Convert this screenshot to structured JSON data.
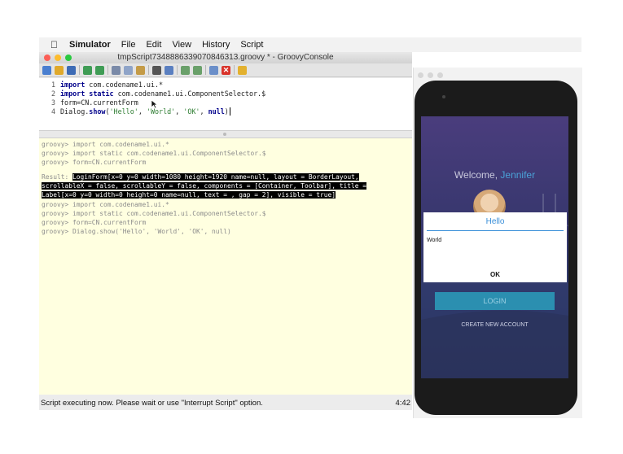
{
  "menubar": {
    "apple": "",
    "app_name": "Simulator",
    "items": [
      "File",
      "Edit",
      "View",
      "History",
      "Script"
    ]
  },
  "groovy": {
    "title": "tmpScript7348886339070846313.groovy * - GroovyConsole",
    "editor_lines": [
      {
        "num": "1",
        "kw": "import",
        "rest": " com.codename1.ui.*"
      },
      {
        "num": "2",
        "kw": "import static",
        "rest": " com.codename1.ui.ComponentSelector.$"
      },
      {
        "num": "3",
        "kw": "",
        "rest": "form=CN.currentForm"
      },
      {
        "num": "4",
        "pre": "Dialog.",
        "kw": "show",
        "open": "(",
        "s1": "'Hello'",
        "c1": ", ",
        "s2": "'World'",
        "c2": ", ",
        "s3": "'OK'",
        "c3": ", ",
        "kw2": "null",
        "close": ")"
      }
    ],
    "output_lines": [
      "groovy> import com.codename1.ui.*",
      "groovy> import static com.codename1.ui.ComponentSelector.$",
      "groovy> form=CN.currentForm"
    ],
    "result_label": "Result:",
    "result_lines": [
      "LoginForm[x=0 y=0 width=1080 height=1920 name=null, layout = BorderLayout,",
      "scrollableX = false, scrollableY = false, components = [Container, Toolbar], title =",
      "Label[x=0 y=0 width=0 height=0 name=null, text = , gap = 2], visible = true]"
    ],
    "output_lines_2": [
      "groovy> import com.codename1.ui.*",
      "groovy> import static com.codename1.ui.ComponentSelector.$",
      "groovy> form=CN.currentForm",
      "groovy> Dialog.show('Hello', 'World', 'OK', null)"
    ],
    "status_text": "Script executing now. Please wait or use \"Interrupt Script\" option.",
    "status_pos": "4:42"
  },
  "phone": {
    "welcome": "Welcome,",
    "name": "Jennifer",
    "dialog_title": "Hello",
    "dialog_body": "World",
    "dialog_ok": "OK",
    "login": "LOGIN",
    "create_account": "CREATE NEW ACCOUNT",
    "accent_color": "#2b8fb0"
  }
}
